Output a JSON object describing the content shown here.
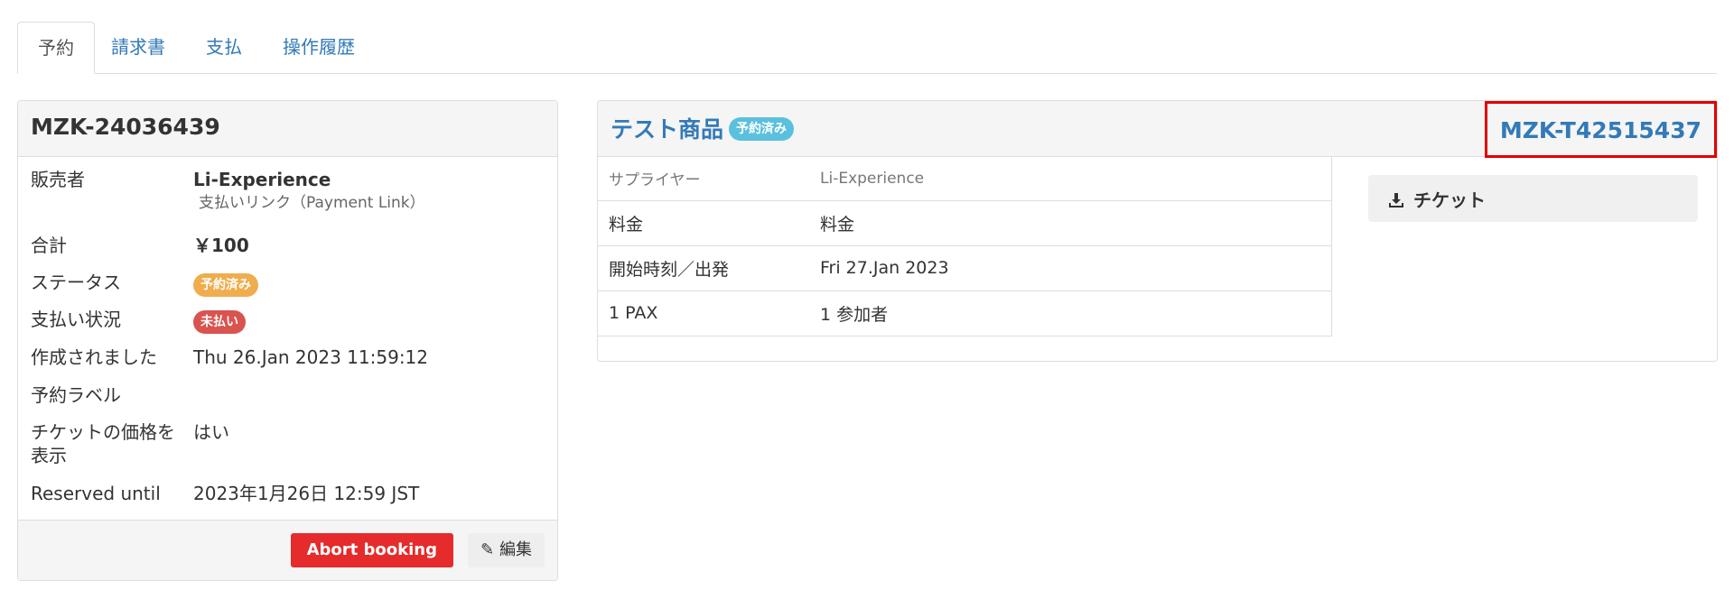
{
  "tabs": [
    {
      "label": "予約",
      "active": true
    },
    {
      "label": "請求書",
      "active": false
    },
    {
      "label": "支払",
      "active": false
    },
    {
      "label": "操作履歴",
      "active": false
    }
  ],
  "booking": {
    "id": "MZK-24036439",
    "seller_label": "販売者",
    "seller_name": "Li-Experience",
    "seller_sub": "支払いリンク（Payment Link）",
    "total_label": "合計",
    "total_value": "￥100",
    "status_label": "ステータス",
    "status_badge": "予約済み",
    "payment_label": "支払い状況",
    "payment_badge": "未払い",
    "created_label": "作成されました",
    "created_value": "Thu 26.Jan 2023 11:59:12",
    "booking_label_label": "予約ラベル",
    "ticket_price_label_1": "チケットの価格を",
    "ticket_price_label_2": "表示",
    "ticket_price_value": "はい",
    "reserved_until_label": "Reserved until",
    "reserved_until_value": "2023年1月26日 12:59 JST",
    "abort_button": "Abort booking",
    "edit_button": "編集"
  },
  "product": {
    "title": "テスト商品",
    "badge": "予約済み",
    "reference": "MZK-T42515437",
    "rows": [
      {
        "label": "サプライヤー",
        "value": "Li-Experience"
      },
      {
        "label": "料金",
        "value": "料金"
      },
      {
        "label": "開始時刻／出発",
        "value": "Fri 27.Jan 2023"
      },
      {
        "label": "1 PAX",
        "value": "1 参加者"
      }
    ],
    "ticket_button": "チケット"
  },
  "colors": {
    "link": "#337ab7",
    "warning": "#f0ad4e",
    "danger": "#d9534f",
    "info": "#5bc0de",
    "abort": "#e52b2b",
    "highlight": "#e00000"
  }
}
